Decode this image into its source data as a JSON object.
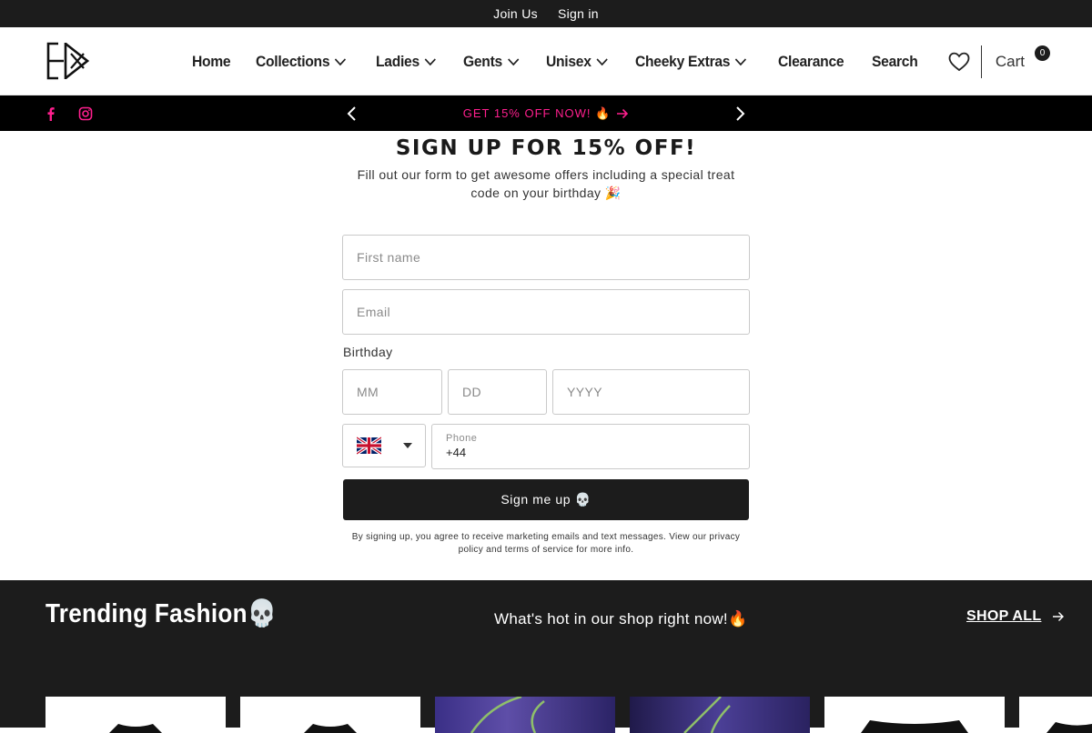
{
  "topbar": {
    "join": "Join Us",
    "signin": "Sign in"
  },
  "nav": {
    "items": [
      {
        "label": "Home",
        "dropdown": false
      },
      {
        "label": "Collections",
        "dropdown": true
      },
      {
        "label": "Ladies",
        "dropdown": true
      },
      {
        "label": "Gents",
        "dropdown": true
      },
      {
        "label": "Unisex",
        "dropdown": true
      },
      {
        "label": "Cheeky Extras",
        "dropdown": true
      },
      {
        "label": "Clearance",
        "dropdown": false
      },
      {
        "label": "Search",
        "dropdown": false
      }
    ]
  },
  "cart": {
    "label": "Cart",
    "count": "0"
  },
  "promo": {
    "text": "GET 15% OFF NOW! 🔥",
    "color": "#ff1f8e"
  },
  "signup": {
    "title": "SIGN UP FOR 15% OFF!",
    "subtitle": "Fill out our form to get awesome offers including a special treat code on your birthday 🎉",
    "first_name_placeholder": "First name",
    "email_placeholder": "Email",
    "birthday_label": "Birthday",
    "mm_placeholder": "MM",
    "dd_placeholder": "DD",
    "yyyy_placeholder": "YYYY",
    "phone_label": "Phone",
    "phone_value": "+44",
    "submit_label": "Sign me up 💀",
    "disclaimer": "By signing up, you agree to receive marketing emails and text messages. View our privacy policy and terms of service for more info."
  },
  "trending": {
    "title": "Trending Fashion💀",
    "subtitle": "What's hot in our shop right now!🔥",
    "shop_all": "SHOP ALL"
  }
}
